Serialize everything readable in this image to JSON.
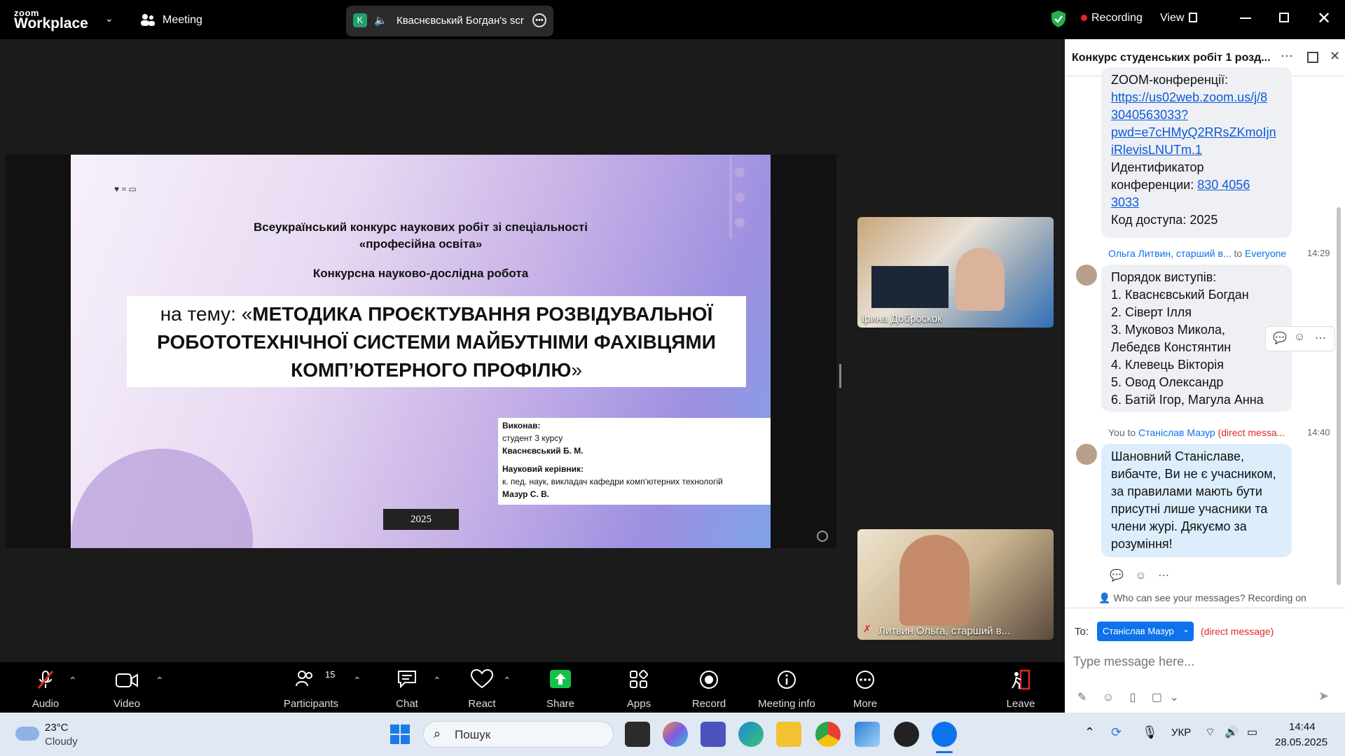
{
  "titlebar": {
    "logo_top": "zoom",
    "logo_bottom": "Workplace",
    "meeting_label": "Meeting",
    "share_badge": "K",
    "share_title": "Кваснєвський Богдан's scr",
    "recording": "Recording",
    "view": "View"
  },
  "slide": {
    "line1": "Всеукраїнський конкурс наукових робіт зі спеціальності",
    "line2": "«професійна освіта»",
    "line3": "Конкурсна науково-дослідна робота",
    "topic_prefix": "на тему: «",
    "topic_a": "МЕТОДИКА ПРОЄКТУВАННЯ РОЗВІДУВАЛЬНОЇ",
    "topic_b": "РОБОТОТЕХНІЧНОЇ СИСТЕМИ МАЙБУТНІМИ ФАХІВЦЯМИ",
    "topic_c": "КОМП’ЮТЕРНОГО ПРОФІЛЮ",
    "topic_suffix": "»",
    "executed_label": "Виконав:",
    "executed_role": "студент 3 курсу",
    "executed_name": "Кваснєвський Б. М.",
    "supervisor_label": "Науковий керівник:",
    "supervisor_role": "к. пед. наук, викладач кафедри комп’ютерних технологій",
    "supervisor_name": "Мазур С. В.",
    "year": "2025"
  },
  "videos": [
    {
      "name": "Ірина Доброскок"
    },
    {
      "name": "Литвин Ольга, старший в..."
    }
  ],
  "chat": {
    "title": "Конкурс студенських робіт 1 розд...",
    "first_msg": {
      "line0": "ZOOM-конференції:",
      "link": "https://us02web.zoom.us/j/83040563033?pwd=e7cHMyQ2RRsZKmoIjniRlevisLNUTm.1",
      "link_lines": [
        "https://us02web.zoom.us/j/8",
        "3040563033?",
        "pwd=e7cHMyQ2RRsZKmoIjn",
        "iRlevisLNUTm.1"
      ],
      "id_label": "Идентификатор",
      "id_label2": "конференции:",
      "id_value1": "830 4056",
      "id_value2": "3033",
      "code": "Код доступа: 2025"
    },
    "second_msg": {
      "sender": "Ольга Литвин, старший в...",
      "to": "to",
      "recipient": "Everyone",
      "time": "14:29",
      "lines": [
        "Порядок виступів:",
        "1. Кваснєвський Богдан",
        "2. Сіверт Ілля",
        "3. Муковоз Микола,",
        "Лебедєв Констянтин",
        "4. Клевець Вікторія",
        "5. Овод Олександр",
        "6. Батій Ігор, Магула Анна"
      ]
    },
    "third_msg": {
      "sender": "You to",
      "recipient": "Станіслав Мазур",
      "direct": "(direct messa...",
      "time": "14:40",
      "lines": [
        "Шановний Станіславе,",
        "вибачте, Ви не є учасником,",
        "за правилами мають бути",
        "присутні лише учасники та",
        "члени журі. Дякуємо за",
        "розуміння!"
      ]
    },
    "who_can_see": "Who can see your messages? Recording on",
    "to_label": "To:",
    "to_recipient": "Станіслав Мазур",
    "direct_message": "(direct message)",
    "input_placeholder": "Type message here..."
  },
  "toolbar": {
    "audio": "Audio",
    "video": "Video",
    "participants": "Participants",
    "participants_count": "15",
    "chat": "Chat",
    "react": "React",
    "share": "Share",
    "apps": "Apps",
    "record": "Record",
    "meeting_info": "Meeting info",
    "more": "More",
    "leave": "Leave"
  },
  "taskbar": {
    "temp": "23°C",
    "weather": "Cloudy",
    "search": "Пошук",
    "lang": "УКР",
    "time": "14:44",
    "date": "28.05.2025"
  },
  "colors": {
    "accent": "#0e72ed",
    "share_green": "#12c24a",
    "leave_red": "#e02828",
    "record_red": "#e02828"
  }
}
